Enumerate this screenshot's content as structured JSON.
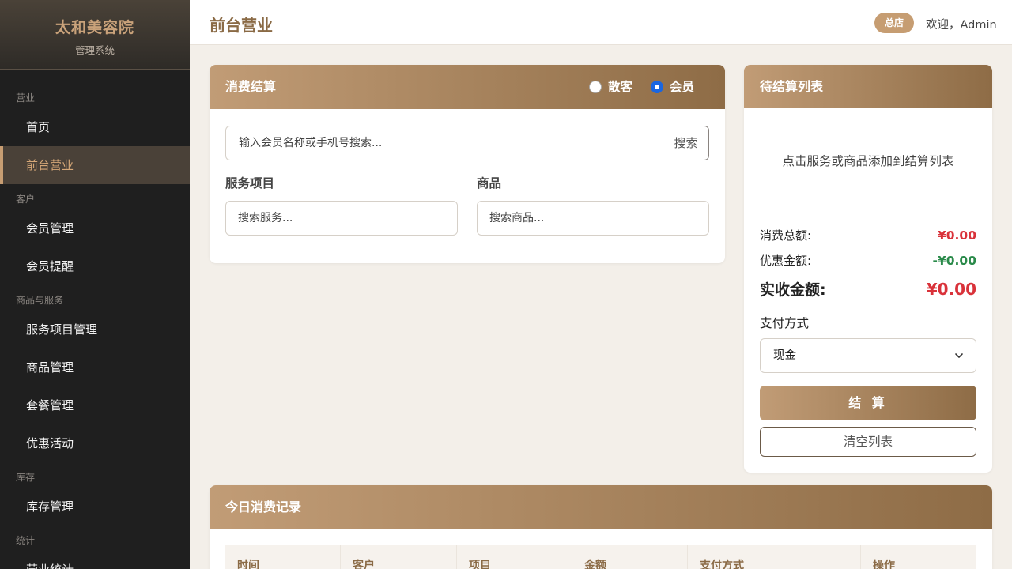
{
  "brand": {
    "title": "太和美容院",
    "subtitle": "管理系统"
  },
  "sidebar": {
    "groups": [
      {
        "label": "营业",
        "items": [
          "首页",
          "前台营业"
        ]
      },
      {
        "label": "客户",
        "items": [
          "会员管理",
          "会员提醒"
        ]
      },
      {
        "label": "商品与服务",
        "items": [
          "服务项目管理",
          "商品管理",
          "套餐管理",
          "优惠活动"
        ]
      },
      {
        "label": "库存",
        "items": [
          "库存管理"
        ]
      },
      {
        "label": "统计",
        "items": [
          "营业统计"
        ]
      }
    ],
    "active_item": "前台营业"
  },
  "header": {
    "title": "前台营业",
    "store_badge": "总店",
    "welcome": "欢迎，Admin"
  },
  "checkout": {
    "title": "消费结算",
    "customer_types": [
      {
        "label": "散客",
        "checked": false
      },
      {
        "label": "会员",
        "checked": true
      }
    ],
    "member_search_placeholder": "输入会员名称或手机号搜索...",
    "search_button": "搜索",
    "services_label": "服务项目",
    "services_placeholder": "搜索服务...",
    "products_label": "商品",
    "products_placeholder": "搜索商品..."
  },
  "pending": {
    "title": "待结算列表",
    "empty_text": "点击服务或商品添加到结算列表",
    "total_label": "消费总额:",
    "total_value": "¥0.00",
    "discount_label": "优惠金额:",
    "discount_value": "-¥0.00",
    "actual_label": "实收金额:",
    "actual_value": "¥0.00",
    "payment_label": "支付方式",
    "payment_selected": "现金",
    "checkout_button": "结 算",
    "clear_button": "清空列表"
  },
  "records": {
    "title": "今日消费记录",
    "columns": [
      "时间",
      "客户",
      "项目",
      "金额",
      "支付方式",
      "操作"
    ]
  },
  "colors": {
    "accent": "#c69d72",
    "accent_dark": "#8e6c46",
    "sidebar_bg": "#1f1f1f",
    "price_red": "#d9323a",
    "discount_green": "#2a8a4a"
  }
}
